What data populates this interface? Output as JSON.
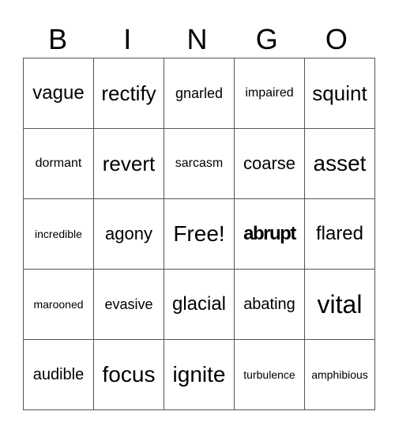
{
  "header": [
    "B",
    "I",
    "N",
    "G",
    "O"
  ],
  "rows": [
    [
      "vague",
      "rectify",
      "gnarled",
      "impaired",
      "squint"
    ],
    [
      "dormant",
      "revert",
      "sarcasm",
      "coarse",
      "asset"
    ],
    [
      "incredible",
      "agony",
      "Free!",
      "abrupt",
      "flared"
    ],
    [
      "marooned",
      "evasive",
      "glacial",
      "abating",
      "vital"
    ],
    [
      "audible",
      "focus",
      "ignite",
      "turbulence",
      "amphibious"
    ]
  ]
}
